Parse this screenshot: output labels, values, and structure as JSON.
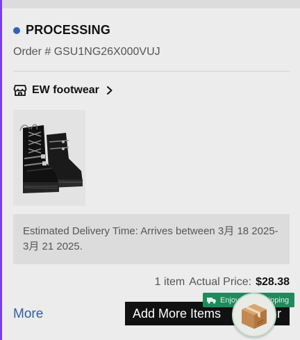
{
  "order": {
    "status": "PROCESSING",
    "status_color": "#2f63b8",
    "order_number_line": "Order # GSU1NG26X000VUJ"
  },
  "store": {
    "name": "EW footwear",
    "icon": "store-icon",
    "chevron": "chevron-right-icon"
  },
  "product": {
    "image": "black-platform-boots-image"
  },
  "delivery": {
    "text": "Estimated Delivery Time: Arrives between 3月 18 2025-3月 21 2025."
  },
  "summary": {
    "count": "1 item",
    "price_label": "Actual Price:",
    "price_value": "$28.38"
  },
  "actions": {
    "more_label": "More",
    "add_more_label": "Add More Items",
    "add_more_trailing": "r",
    "accent_link_color": "#2f5fa8"
  },
  "promo": {
    "banner_text": "Enjoy Free Shipping",
    "banner_color": "#1f8a5c",
    "fab_icon": "package-box-icon"
  }
}
